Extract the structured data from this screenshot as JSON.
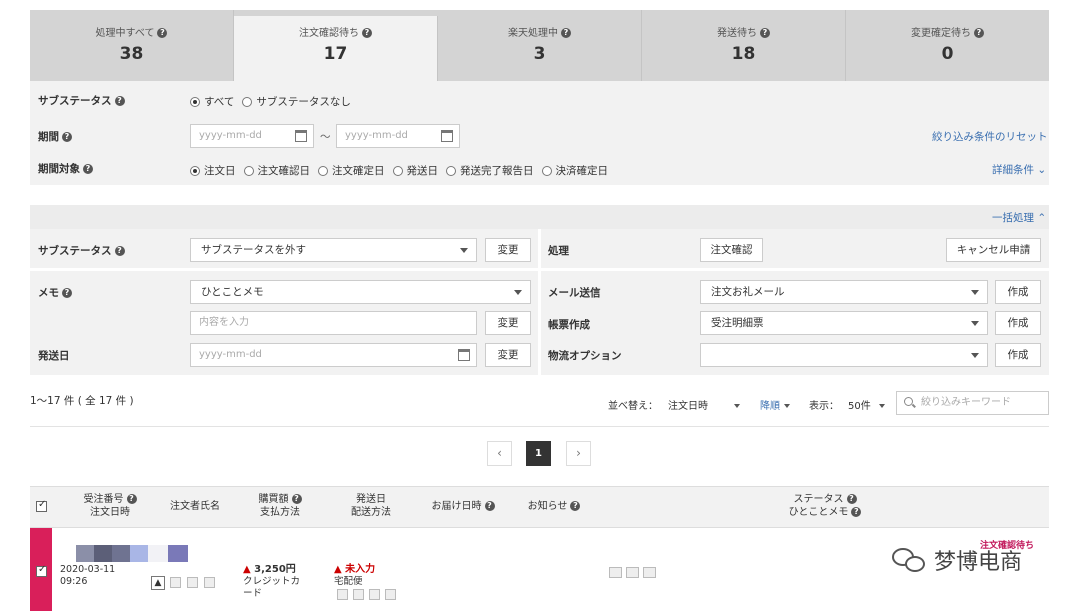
{
  "status_tabs": [
    {
      "label": "処理中すべて",
      "count": "38"
    },
    {
      "label": "注文確認待ち",
      "count": "17"
    },
    {
      "label": "楽天処理中",
      "count": "3"
    },
    {
      "label": "発送待ち",
      "count": "18"
    },
    {
      "label": "変更確定待ち",
      "count": "0"
    }
  ],
  "filter": {
    "substatus_label": "サブステータス",
    "substatus_options": [
      "すべて",
      "サブステータスなし"
    ],
    "period_label": "期間",
    "date_placeholder": "yyyy-mm-dd",
    "tilde": "～",
    "reset_link": "絞り込み条件のリセット",
    "period_target_label": "期間対象",
    "period_target_options": [
      "注文日",
      "注文確認日",
      "注文確定日",
      "発送日",
      "発送完了報告日",
      "決済確定日"
    ],
    "detail_link": "詳細条件"
  },
  "bulk": {
    "toggle_label": "一括処理",
    "substatus_label": "サブステータス",
    "substatus_select": "サブステータスを外す",
    "change_label": "変更",
    "process_label": "処理",
    "confirm_button": "注文確認",
    "cancel_button": "キャンセル申請",
    "memo_label": "メモ",
    "memo_select": "ひとことメモ",
    "memo_placeholder": "内容を入力",
    "mail_label": "メール送信",
    "mail_select": "注文お礼メール",
    "create_label": "作成",
    "form_label": "帳票作成",
    "form_select": "受注明細票",
    "ship_date_label": "発送日",
    "logistics_label": "物流オプション",
    "logistics_select": ""
  },
  "listing": {
    "count_text": "1〜17 件 ( 全 17 件 )",
    "sort_label": "並べ替え：",
    "sort_field": "注文日時",
    "sort_order": "降順",
    "display_label": "表示：",
    "display_count": "50件",
    "search_placeholder": "絞り込みキーワード",
    "pages": [
      "1"
    ]
  },
  "table": {
    "headers": {
      "order_no": "受注番号",
      "order_datetime": "注文日時",
      "customer": "注文者氏名",
      "amount": "購買額",
      "payment": "支払方法",
      "ship_date": "発送日",
      "ship_method": "配送方法",
      "delivery_date": "お届け日時",
      "notice": "お知らせ",
      "status": "ステータス",
      "memo": "ひとことメモ"
    },
    "rows": [
      {
        "status_text": "注文確認待ち",
        "date": "2020-03-11",
        "time": "09:26",
        "amount": "3,250円",
        "payment": "クレジットカード",
        "ship_status": "未入力",
        "ship_method": "宅配便"
      }
    ]
  },
  "watermark": "梦博电商",
  "colors": {
    "accent": "#d91f5a",
    "warning": "#cc0000",
    "link": "#3a6fb0"
  }
}
